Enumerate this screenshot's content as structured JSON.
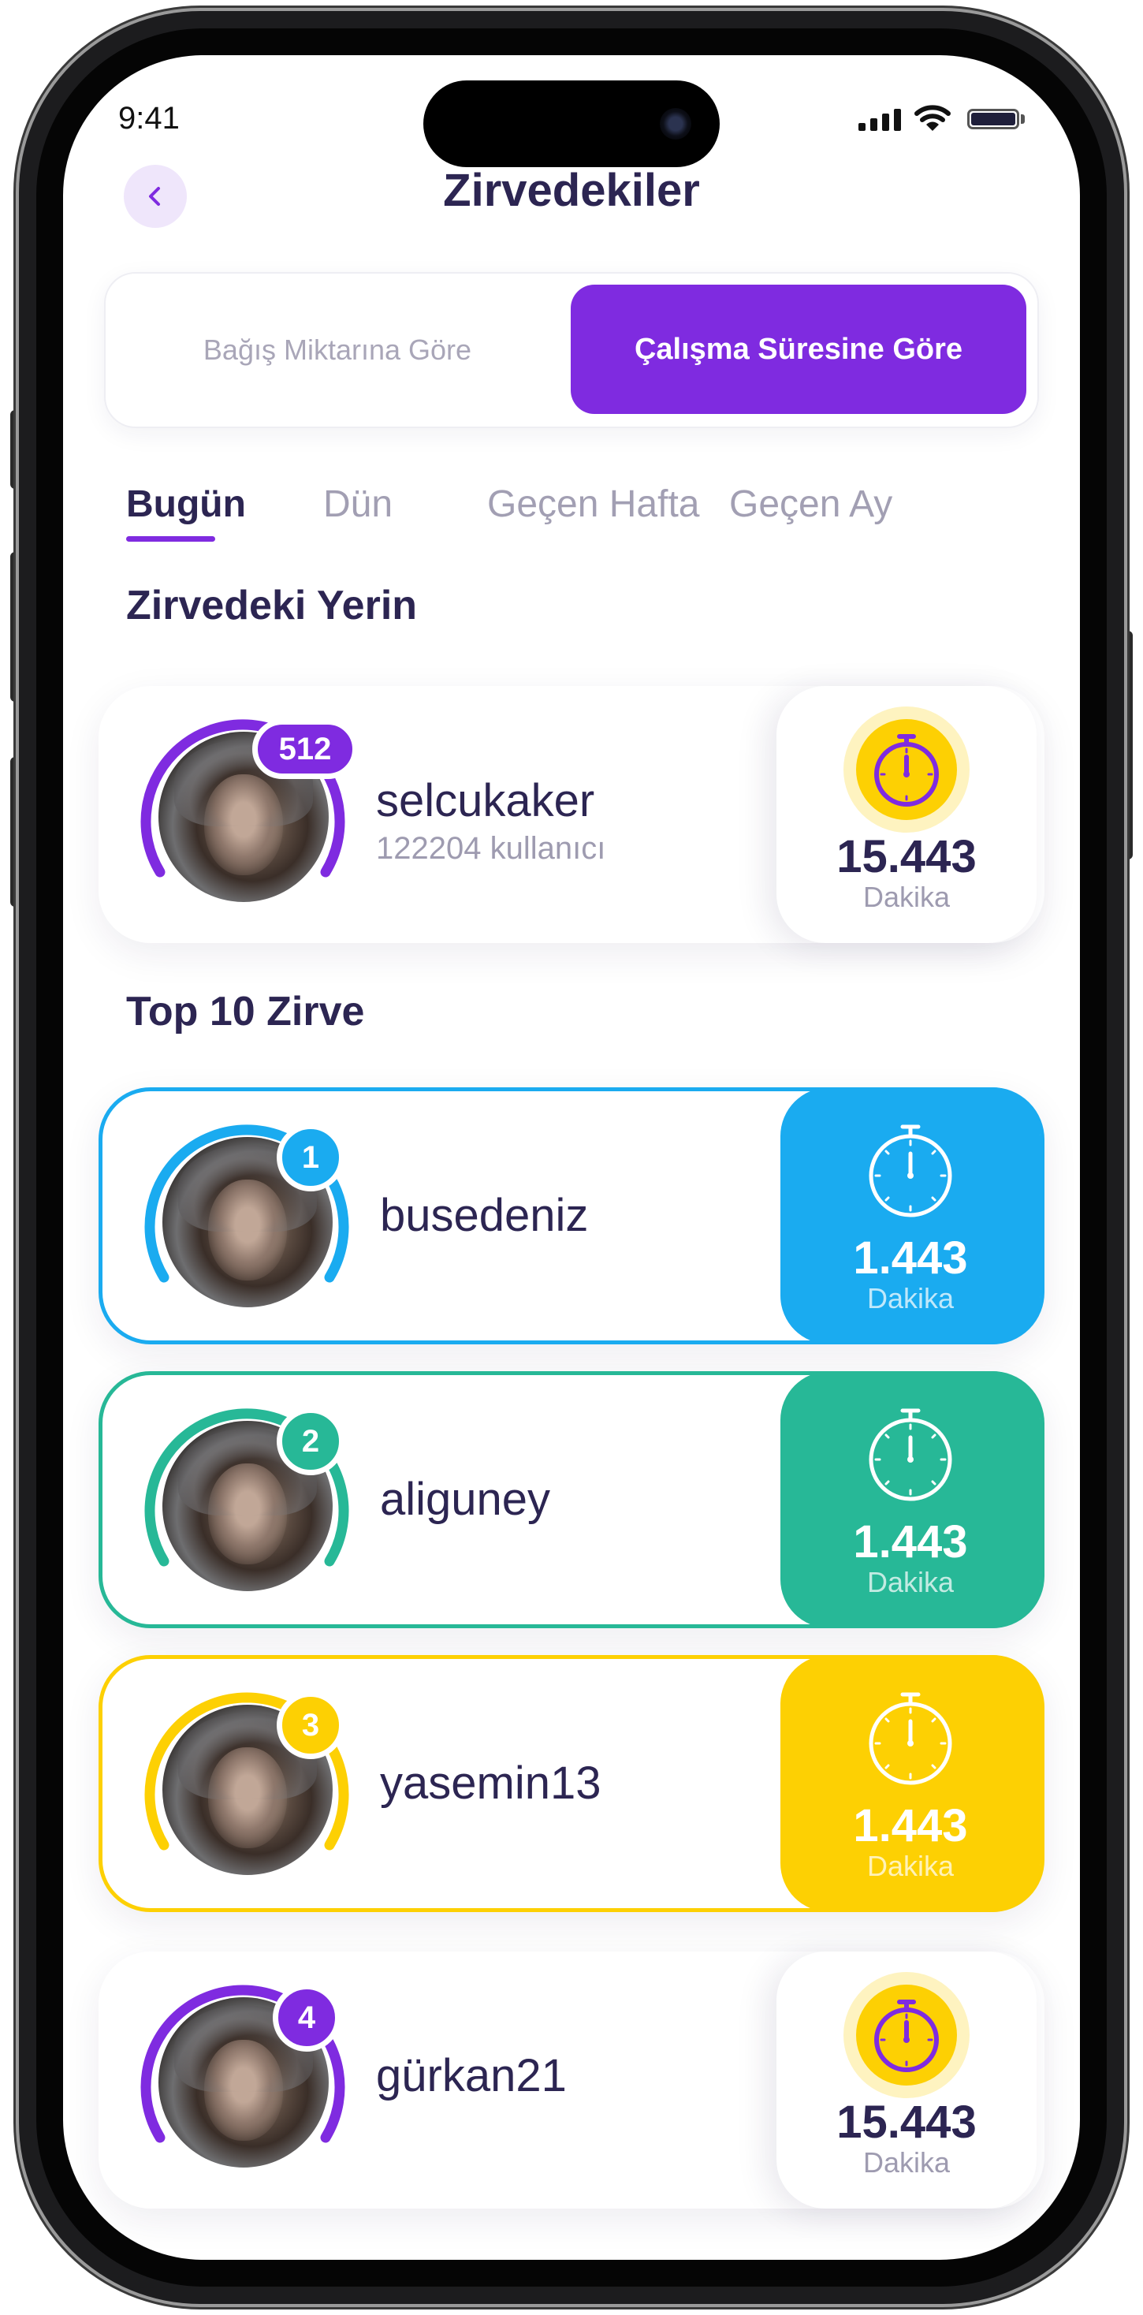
{
  "status_bar": {
    "time": "9:41"
  },
  "header": {
    "title": "Zirvedekiler",
    "back_icon": "chevron-left-icon"
  },
  "segment": {
    "options": [
      "Bağış Miktarına Göre",
      "Çalışma Süresine Göre"
    ],
    "selected": "Çalışma Süresine Göre"
  },
  "tabs": {
    "items": [
      "Bugün",
      "Dün",
      "Geçen Hafta",
      "Geçen Ay"
    ],
    "active": "Bugün"
  },
  "my_rank": {
    "section_title": "Zirvedeki Yerin",
    "rank": "512",
    "username": "selcukaker",
    "subtitle": "122204 kullanıcı",
    "value": "15.443",
    "unit": "Dakika",
    "icon": "stopwatch-icon"
  },
  "top10": {
    "section_title": "Top 10 Zirve",
    "entries": [
      {
        "rank": "1",
        "username": "busedeniz",
        "value": "1.443",
        "unit": "Dakika",
        "color": "#1aabf0",
        "style": "filled"
      },
      {
        "rank": "2",
        "username": "aliguney",
        "value": "1.443",
        "unit": "Dakika",
        "color": "#27b897",
        "style": "filled"
      },
      {
        "rank": "3",
        "username": "yasemin13",
        "value": "1.443",
        "unit": "Dakika",
        "color": "#fdd003",
        "style": "filled"
      },
      {
        "rank": "4",
        "username": "gürkan21",
        "value": "15.443",
        "unit": "Dakika",
        "color": "#7f2be0",
        "style": "white"
      }
    ]
  },
  "colors": {
    "primary": "#7f2be0",
    "title_text": "#2c2552",
    "muted_text": "#a29fb3",
    "gold": "#fdd003",
    "blue": "#1aabf0",
    "green": "#27b897"
  }
}
